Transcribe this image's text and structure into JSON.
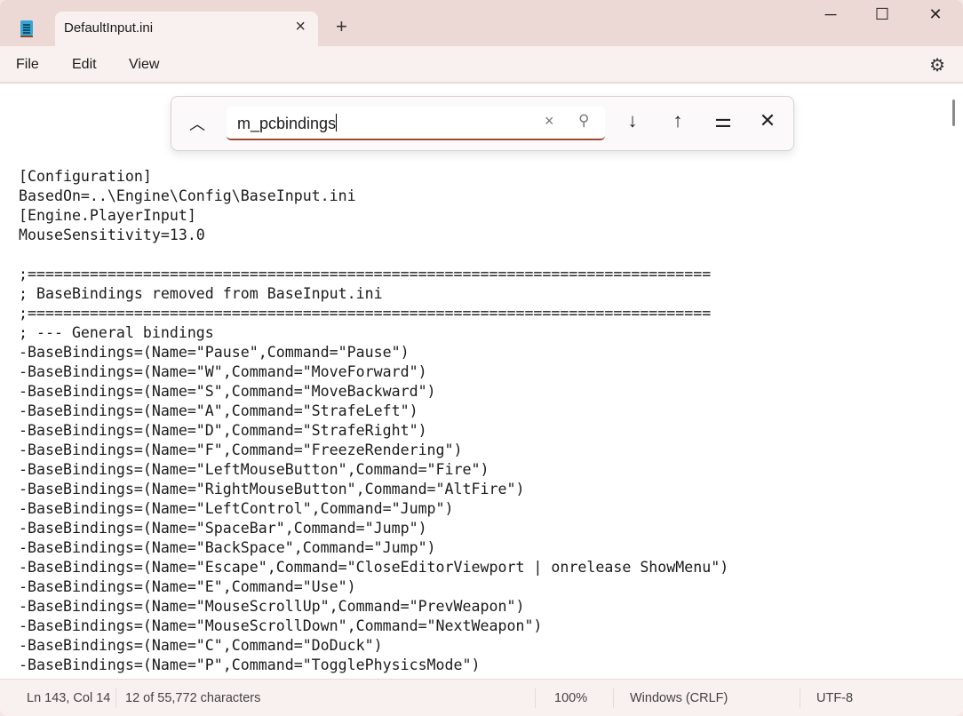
{
  "app": {
    "tab_title": "DefaultInput.ini",
    "new_tab": "+",
    "minimize": "─",
    "maximize": "☐",
    "close": "✕"
  },
  "menu": {
    "file": "File",
    "edit": "Edit",
    "view": "View"
  },
  "find": {
    "query": "m_pcbindings"
  },
  "editor_lines": [
    "[Configuration]",
    "BasedOn=..\\Engine\\Config\\BaseInput.ini",
    "[Engine.PlayerInput]",
    "MouseSensitivity=13.0",
    "",
    ";=============================================================================",
    "; BaseBindings removed from BaseInput.ini",
    ";=============================================================================",
    "; --- General bindings",
    "-BaseBindings=(Name=\"Pause\",Command=\"Pause\")",
    "-BaseBindings=(Name=\"W\",Command=\"MoveForward\")",
    "-BaseBindings=(Name=\"S\",Command=\"MoveBackward\")",
    "-BaseBindings=(Name=\"A\",Command=\"StrafeLeft\")",
    "-BaseBindings=(Name=\"D\",Command=\"StrafeRight\")",
    "-BaseBindings=(Name=\"F\",Command=\"FreezeRendering\")",
    "-BaseBindings=(Name=\"LeftMouseButton\",Command=\"Fire\")",
    "-BaseBindings=(Name=\"RightMouseButton\",Command=\"AltFire\")",
    "-BaseBindings=(Name=\"LeftControl\",Command=\"Jump\")",
    "-BaseBindings=(Name=\"SpaceBar\",Command=\"Jump\")",
    "-BaseBindings=(Name=\"BackSpace\",Command=\"Jump\")",
    "-BaseBindings=(Name=\"Escape\",Command=\"CloseEditorViewport | onrelease ShowMenu\")",
    "-BaseBindings=(Name=\"E\",Command=\"Use\")",
    "-BaseBindings=(Name=\"MouseScrollUp\",Command=\"PrevWeapon\")",
    "-BaseBindings=(Name=\"MouseScrollDown\",Command=\"NextWeapon\")",
    "-BaseBindings=(Name=\"C\",Command=\"DoDuck\")",
    "-BaseBindings=(Name=\"P\",Command=\"TogglePhysicsMode\")"
  ],
  "status": {
    "position": "Ln 143, Col 14",
    "selection": "12 of 55,772 characters",
    "zoom": "100%",
    "line_ending": "Windows (CRLF)",
    "encoding": "UTF-8"
  }
}
